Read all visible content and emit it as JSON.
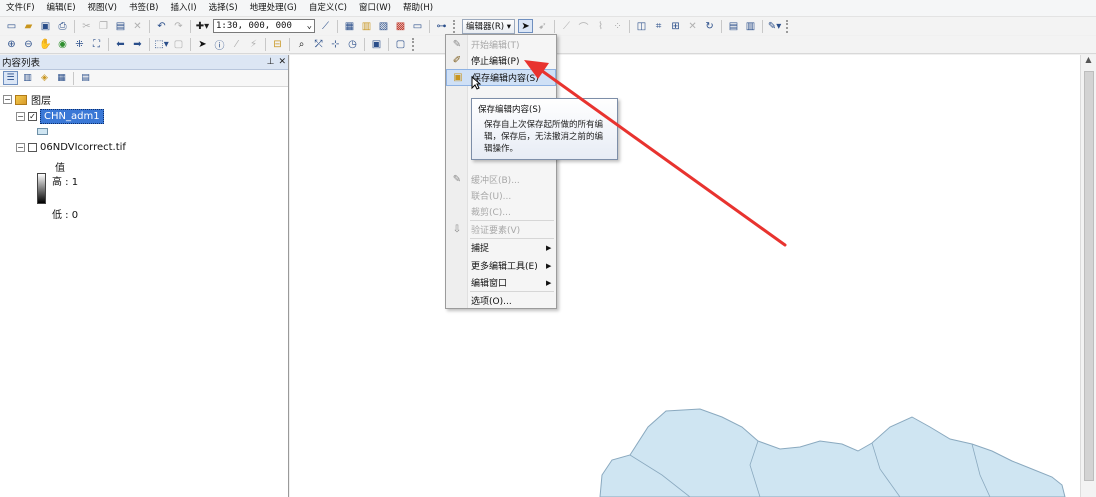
{
  "menu": [
    "文件(F)",
    "编辑(E)",
    "视图(V)",
    "书签(B)",
    "插入(I)",
    "选择(S)",
    "地理处理(G)",
    "自定义(C)",
    "窗口(W)",
    "帮助(H)"
  ],
  "toolbar": {
    "scale_value": "1:30, 000, 000",
    "editor_label": "编辑器(R) ▾"
  },
  "toc": {
    "title": "内容列表",
    "root_label": "图层",
    "layer1_label": "CHN_adm1",
    "layer2_label": "06NDVIcorrect.tif",
    "legend_value_label": "值",
    "legend_high_label": "高 : 1",
    "legend_low_label": "低 : 0"
  },
  "editor_menu": [
    {
      "label": "开始编辑(T)",
      "disabled": true,
      "icon": "start-edit-icon"
    },
    {
      "label": "停止编辑(P)",
      "disabled": false,
      "icon": "stop-edit-icon"
    },
    {
      "label": "保存编辑内容(S)",
      "disabled": false,
      "icon": "save-edits-icon",
      "highlighted": true
    },
    {
      "label": "缓冲区(B)...",
      "disabled": true,
      "icon": "buffer-icon"
    },
    {
      "label": "联合(U)...",
      "disabled": true,
      "icon": ""
    },
    {
      "label": "裁剪(C)...",
      "disabled": true,
      "icon": ""
    },
    {
      "label": "验证要素(V)",
      "disabled": true,
      "icon": "validate-icon"
    },
    {
      "label": "捕捉",
      "disabled": false,
      "icon": "",
      "submenu": true
    },
    {
      "label": "更多编辑工具(E)",
      "disabled": false,
      "icon": "",
      "submenu": true
    },
    {
      "label": "编辑窗口",
      "disabled": false,
      "icon": "",
      "submenu": true
    },
    {
      "label": "选项(O)...",
      "disabled": false,
      "icon": ""
    }
  ],
  "tooltip": {
    "title": "保存编辑内容(S)",
    "body": "保存自上次保存起所做的所有编辑，保存后，无法撤消之前的编辑操作。"
  },
  "colors": {
    "map_land": "#cfe5f2",
    "map_border": "#8aa9bf",
    "arrow": "#e8332f",
    "selection": "#3a78d6"
  }
}
